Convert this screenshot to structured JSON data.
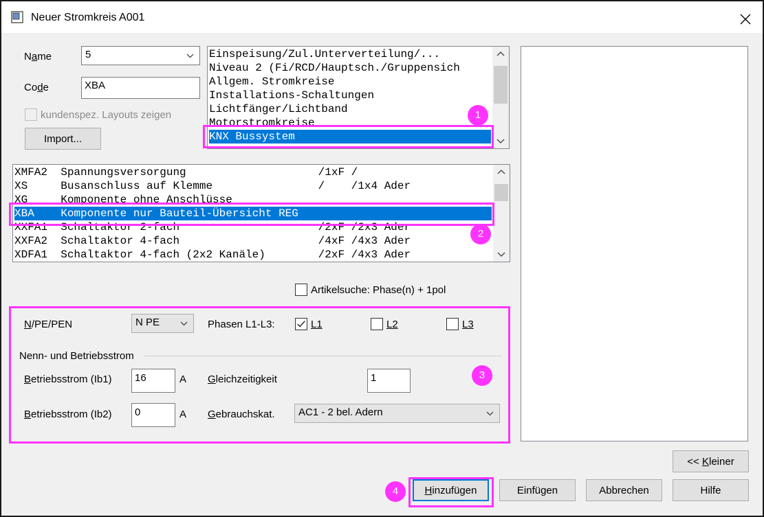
{
  "window": {
    "title": "Neuer Stromkreis  A001"
  },
  "name_field": {
    "label_pre": "N",
    "label_u": "a",
    "label_post": "me",
    "value": "5"
  },
  "code_field": {
    "label_pre": "Co",
    "label_u": "d",
    "label_post": "e",
    "value": "XBA"
  },
  "custom_layouts": {
    "label": "kundenspez. Layouts zeigen",
    "checked": false
  },
  "import_button": "Import...",
  "category_list": {
    "items": [
      "Einspeisung/Zul.Unterverteilung/...",
      "Niveau 2 (Fi/RCD/Hauptsch./Gruppensich",
      "Allgem. Stromkreise",
      "Installations-Schaltungen",
      "Lichtfänger/Lichtband",
      "Motorstromkreise",
      "KNX Bussystem"
    ],
    "selected_index": 6
  },
  "layout_list": {
    "items": [
      "XMFA2  Spannungsversorgung                    /1xF /",
      "XS     Busanschluss auf Klemme                /    /1x4 Ader",
      "XG     Komponente ohne Anschlüsse",
      "XBA    Komponente nur Bauteil-Übersicht REG",
      "XXFA1  Schaltaktor 2-fach                     /2xF /2x3 Ader",
      "XXFA2  Schaltaktor 4-fach                     /4xF /4x3 Ader",
      "XDFA1  Schaltaktor 4-fach (2x2 Kanäle)        /2xF /4x3 Ader"
    ],
    "selected_index": 3
  },
  "article_search": {
    "label": "Artikelsuche: Phase(n) + 1pol",
    "checked": false
  },
  "npe": {
    "label_u": "N",
    "label_post": "/PE/PEN",
    "value": "N PE"
  },
  "phases": {
    "label": "Phasen L1-L3:",
    "l1": "L1",
    "l2": "L2",
    "l3": "L3",
    "l1_checked": true,
    "l2_checked": false,
    "l3_checked": false
  },
  "current_group": {
    "title": "Nenn- und Betriebsstrom"
  },
  "ib1": {
    "label_u": "B",
    "label_post": "etriebsstrom (Ib1)",
    "value": "16",
    "unit": "A"
  },
  "ib2": {
    "label_u": "B",
    "label_post": "etriebsstrom (Ib2)",
    "value": "0",
    "unit": "A"
  },
  "simultaneity": {
    "label_u": "G",
    "label_post": "leichzeitigkeit",
    "value": "1"
  },
  "usage_cat": {
    "label_u": "G",
    "label_post": "ebrauchskat.",
    "value": "AC1 - 2 bel. Adern"
  },
  "buttons": {
    "smaller_pre": "<< ",
    "smaller_u": "K",
    "smaller_post": "leiner",
    "add_u": "H",
    "add_post": "inzufügen",
    "insert": "Einfügen",
    "cancel": "Abbrechen",
    "help": "Hilfe"
  },
  "annotations": {
    "b1": "1",
    "b2": "2",
    "b3": "3",
    "b4": "4",
    "color": "#ff33ff"
  }
}
